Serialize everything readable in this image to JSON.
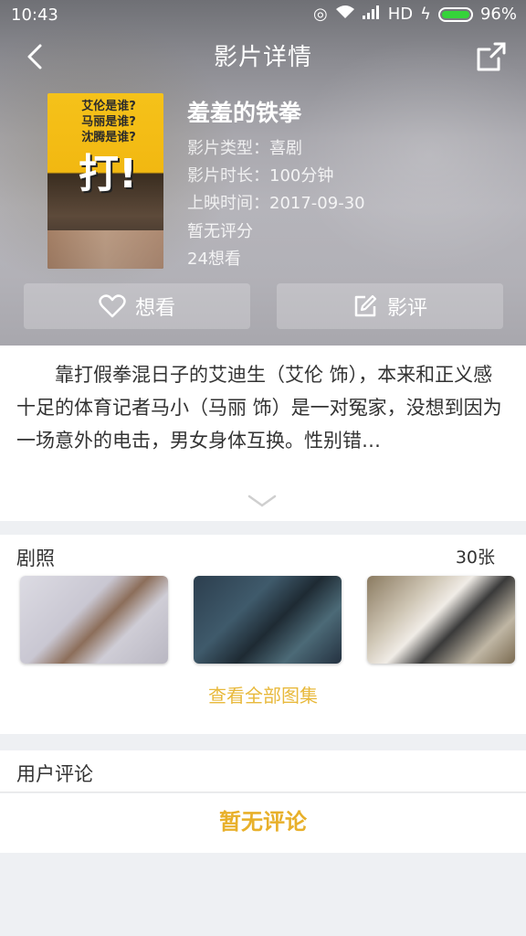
{
  "status": {
    "time": "10:43",
    "network": "HD",
    "battery": "96%"
  },
  "navbar": {
    "title": "影片详情"
  },
  "movie": {
    "title": "羞羞的铁拳",
    "type_label": "影片类型：",
    "type": "喜剧",
    "duration_label": "影片时长：",
    "duration": "100分钟",
    "release_label": "上映时间：",
    "release": "2017-09-30",
    "rating": "暂无评分",
    "wants": "24想看",
    "poster_text": [
      "艾伦是谁?",
      "马丽是谁?",
      "沈腾是谁?"
    ],
    "poster_big": "打!"
  },
  "actions": {
    "want": "想看",
    "review": "影评"
  },
  "synopsis": {
    "text": "靠打假拳混日子的艾迪生（艾伦 饰），本来和正义感十足的体育记者马小（马丽 饰）是一对冤家，没想到因为一场意外的电击，男女身体互换。性别错…"
  },
  "stills": {
    "header": "剧照",
    "count": "30张",
    "view_all": "查看全部图集"
  },
  "comments": {
    "header": "用户评论",
    "empty": "暂无评论"
  },
  "colors": {
    "accent": "#e8b02a",
    "battery": "#35d33a"
  }
}
